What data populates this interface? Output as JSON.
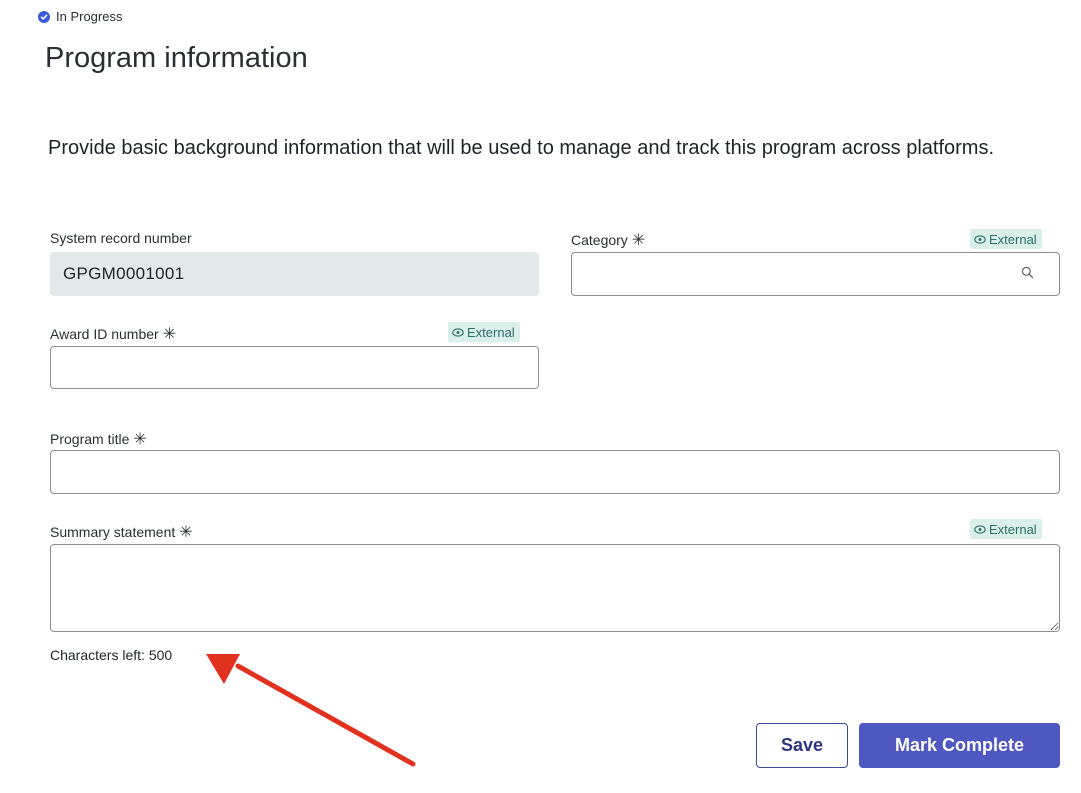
{
  "status": {
    "label": "In Progress",
    "icon": "check-circle-icon",
    "color": "#3b5bdb"
  },
  "page_title": "Program information",
  "intro_text": "Provide basic background information that will be used to manage and track this program across platforms.",
  "required_marker": "✳",
  "external_badge": {
    "label": "External",
    "icon": "eye-icon"
  },
  "fields": {
    "system_record_number": {
      "label": "System record number",
      "value": "GPGM0001001"
    },
    "category": {
      "label": "Category",
      "value": "",
      "icon": "search-icon"
    },
    "award_id": {
      "label": "Award ID number",
      "value": ""
    },
    "program_title": {
      "label": "Program title",
      "value": ""
    },
    "summary_statement": {
      "label": "Summary statement",
      "value": ""
    }
  },
  "characters_left": "Characters left: 500",
  "annotation": {
    "type": "red-arrow",
    "color": "#e0321f"
  },
  "buttons": {
    "save": "Save",
    "mark_complete": "Mark Complete"
  },
  "colors": {
    "accent": "#4f57c0",
    "external_badge_bg": "#d9f0ea",
    "readonly_bg": "#e3e8e8"
  }
}
